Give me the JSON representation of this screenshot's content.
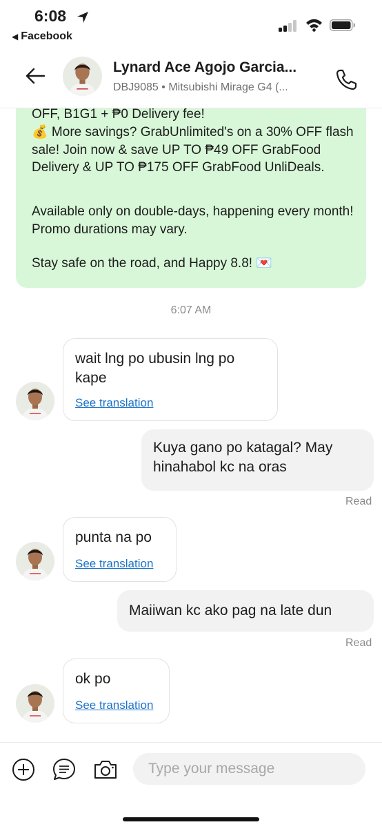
{
  "status": {
    "time": "6:08",
    "back_app": "Facebook"
  },
  "header": {
    "name": "Lynard Ace Agojo Garcia...",
    "vehicle": "DBJ9085 • Mitsubishi Mirage G4 (..."
  },
  "promo": {
    "line1": "OFF, B1G1 + ₱0 Delivery fee!",
    "line2": "💰 More savings? GrabUnlimited's on a 30% OFF flash sale! Join now & save UP TO ₱49 OFF GrabFood Delivery & UP TO ₱175 OFF GrabFood UnliDeals.",
    "line3": "Available only on double-days, happening every month! Promo durations may vary.",
    "line4": "Stay safe on the road, and Happy 8.8! 💌"
  },
  "timestamp": "6:07 AM",
  "messages": [
    {
      "direction": "in",
      "text": "wait lng po ubusin lng po kape",
      "link": "See translation"
    },
    {
      "direction": "out",
      "text": "Kuya gano po katagal? May hinahabol kc na oras",
      "status": "Read"
    },
    {
      "direction": "in",
      "text": "punta na po",
      "link": "See translation"
    },
    {
      "direction": "out",
      "text": "Maiiwan kc ako pag na late dun",
      "status": "Read"
    },
    {
      "direction": "in",
      "text": "ok po",
      "link": "See translation"
    }
  ],
  "composer": {
    "placeholder": "Type your message"
  },
  "icons": [
    "location-arrow-icon",
    "signal-icon",
    "wifi-icon",
    "battery-icon",
    "back-arrow-icon",
    "phone-icon",
    "plus-circle-icon",
    "chat-bubble-icon",
    "camera-icon"
  ],
  "colors": {
    "promo_bg": "#d8f7d8",
    "link": "#1a73c8",
    "outgoing_bg": "#f2f2f2"
  }
}
